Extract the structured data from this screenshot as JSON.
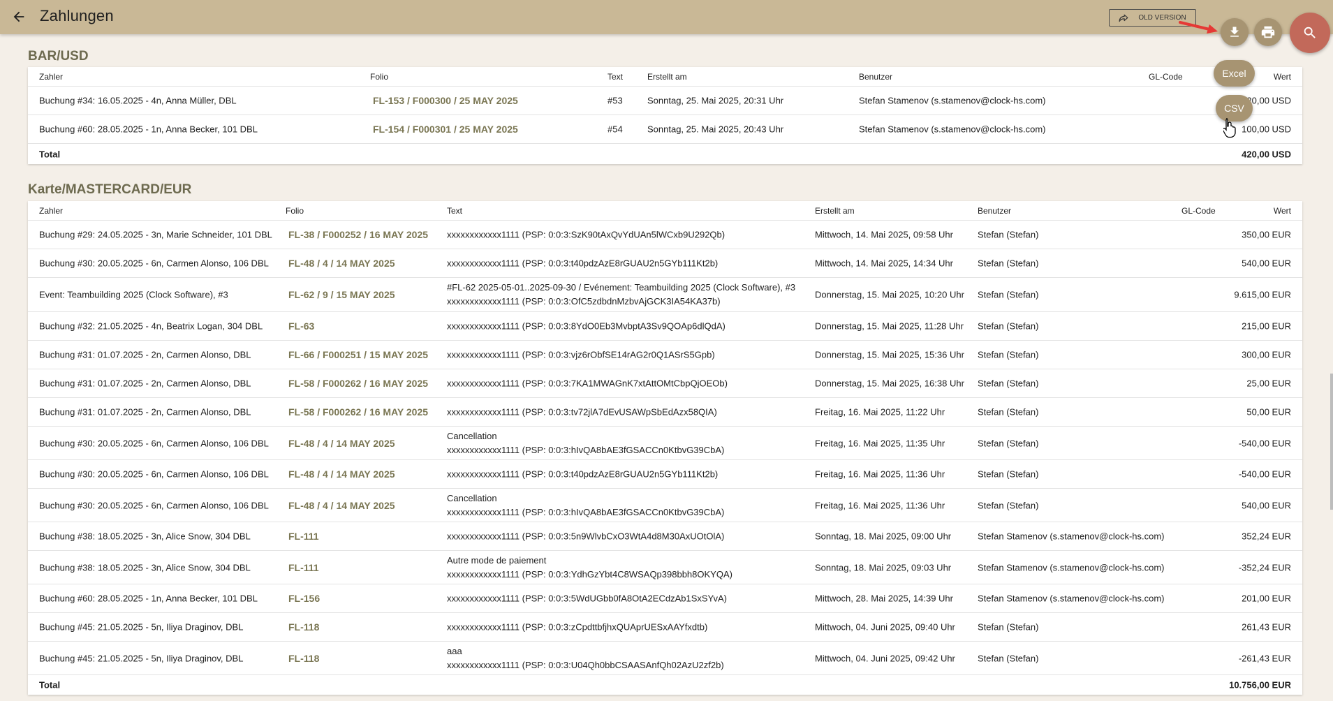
{
  "header": {
    "title": "Zahlungen",
    "old_version_label": "OLD VERSION"
  },
  "export": {
    "excel_label": "Excel",
    "csv_label": "CSV"
  },
  "icons": {
    "back": "arrow-left-icon",
    "old_version": "share-arrow-icon",
    "download": "download-icon",
    "print": "printer-icon",
    "search": "search-icon"
  },
  "colors": {
    "topbar": "#c9b896",
    "accent": "#a79472",
    "search_fab": "#c2695a",
    "folio_link": "#7a7653",
    "annotation_arrow": "#e53935"
  },
  "sections": [
    {
      "title": "BAR/USD",
      "columns": {
        "payer": "Zahler",
        "folio": "Folio",
        "text": "Text",
        "created": "Erstellt am",
        "user": "Benutzer",
        "gl": "GL-Code",
        "value": "Wert"
      },
      "rows": [
        {
          "payer": "Buchung #34: 16.05.2025 - 4n, Anna Müller, DBL",
          "folio": "FL-153 / F000300 / 25 MAY 2025",
          "text": "#53",
          "text2": "",
          "created": "Sonntag, 25. Mai 2025, 20:31 Uhr",
          "user": "Stefan Stamenov (s.stamenov@clock-hs.com)",
          "value": "320,00 USD"
        },
        {
          "payer": "Buchung #60: 28.05.2025 - 1n, Anna Becker, 101 DBL",
          "folio": "FL-154 / F000301 / 25 MAY 2025",
          "text": "#54",
          "text2": "",
          "created": "Sonntag, 25. Mai 2025, 20:43 Uhr",
          "user": "Stefan Stamenov (s.stamenov@clock-hs.com)",
          "value": "100,00 USD"
        }
      ],
      "total_label": "Total",
      "total_value": "420,00 USD"
    },
    {
      "title": "Karte/MASTERCARD/EUR",
      "columns": {
        "payer": "Zahler",
        "folio": "Folio",
        "text": "Text",
        "created": "Erstellt am",
        "user": "Benutzer",
        "gl": "GL-Code",
        "value": "Wert"
      },
      "rows": [
        {
          "payer": "Buchung #29: 24.05.2025 - 3n, Marie Schneider, 101 DBL",
          "folio": "FL-38 / F000252 / 16 MAY 2025",
          "text": "xxxxxxxxxxxx1111 (PSP: 0:0:3:SzK90tAxQvYdUAn5lWCxb9U292Qb)",
          "text2": "",
          "created": "Mittwoch, 14. Mai 2025, 09:58 Uhr",
          "user": "Stefan (Stefan)",
          "value": "350,00 EUR"
        },
        {
          "payer": "Buchung #30: 20.05.2025 - 6n, Carmen Alonso, 106 DBL",
          "folio": "FL-48 / 4 / 14 MAY 2025",
          "text": "xxxxxxxxxxxx1111 (PSP: 0:0:3:t40pdzAzE8rGUAU2n5GYb111Kt2b)",
          "text2": "",
          "created": "Mittwoch, 14. Mai 2025, 14:34 Uhr",
          "user": "Stefan (Stefan)",
          "value": "540,00 EUR"
        },
        {
          "payer": "Event: Teambuilding 2025 (Clock Software), #3",
          "folio": "FL-62 / 9 / 15 MAY 2025",
          "text": "#FL-62 2025-05-01..2025-09-30 / Evénement: Teambuilding 2025 (Clock Software), #3",
          "text2": "xxxxxxxxxxxx1111 (PSP: 0:0:3:OfC5zdbdnMzbvAjGCK3IA54KA37b)",
          "created": "Donnerstag, 15. Mai 2025, 10:20 Uhr",
          "user": "Stefan (Stefan)",
          "value": "9.615,00 EUR"
        },
        {
          "payer": "Buchung #32: 21.05.2025 - 4n, Beatrix Logan, 304 DBL",
          "folio": "FL-63",
          "text": "xxxxxxxxxxxx1111 (PSP: 0:0:3:8YdO0Eb3MvbptA3Sv9QOAp6dlQdA)",
          "text2": "",
          "created": "Donnerstag, 15. Mai 2025, 11:28 Uhr",
          "user": "Stefan (Stefan)",
          "value": "215,00 EUR"
        },
        {
          "payer": "Buchung #31: 01.07.2025 - 2n, Carmen Alonso, DBL",
          "folio": "FL-66 / F000251 / 15 MAY 2025",
          "text": "xxxxxxxxxxxx1111 (PSP: 0:0:3:vjz6rObfSE14rAG2r0Q1ASrS5Gpb)",
          "text2": "",
          "created": "Donnerstag, 15. Mai 2025, 15:36 Uhr",
          "user": "Stefan (Stefan)",
          "value": "300,00 EUR"
        },
        {
          "payer": "Buchung #31: 01.07.2025 - 2n, Carmen Alonso, DBL",
          "folio": "FL-58 / F000262 / 16 MAY 2025",
          "text": "xxxxxxxxxxxx1111 (PSP: 0:0:3:7KA1MWAGnK7xtAttOMtCbpQjOEOb)",
          "text2": "",
          "created": "Donnerstag, 15. Mai 2025, 16:38 Uhr",
          "user": "Stefan (Stefan)",
          "value": "25,00 EUR"
        },
        {
          "payer": "Buchung #31: 01.07.2025 - 2n, Carmen Alonso, DBL",
          "folio": "FL-58 / F000262 / 16 MAY 2025",
          "text": "xxxxxxxxxxxx1111 (PSP: 0:0:3:tv72jlA7dEvUSAWpSbEdAzx58QIA)",
          "text2": "",
          "created": "Freitag, 16. Mai 2025, 11:22 Uhr",
          "user": "Stefan (Stefan)",
          "value": "50,00 EUR"
        },
        {
          "payer": "Buchung #30: 20.05.2025 - 6n, Carmen Alonso, 106 DBL",
          "folio": "FL-48 / 4 / 14 MAY 2025",
          "text": "Cancellation",
          "text2": "xxxxxxxxxxxx1111 (PSP: 0:0:3:hIvQA8bAE3fGSACCn0KtbvG39CbA)",
          "created": "Freitag, 16. Mai 2025, 11:35 Uhr",
          "user": "Stefan (Stefan)",
          "value": "-540,00 EUR"
        },
        {
          "payer": "Buchung #30: 20.05.2025 - 6n, Carmen Alonso, 106 DBL",
          "folio": "FL-48 / 4 / 14 MAY 2025",
          "text": "xxxxxxxxxxxx1111 (PSP: 0:0:3:t40pdzAzE8rGUAU2n5GYb111Kt2b)",
          "text2": "",
          "created": "Freitag, 16. Mai 2025, 11:36 Uhr",
          "user": "Stefan (Stefan)",
          "value": "-540,00 EUR"
        },
        {
          "payer": "Buchung #30: 20.05.2025 - 6n, Carmen Alonso, 106 DBL",
          "folio": "FL-48 / 4 / 14 MAY 2025",
          "text": "Cancellation",
          "text2": "xxxxxxxxxxxx1111 (PSP: 0:0:3:hIvQA8bAE3fGSACCn0KtbvG39CbA)",
          "created": "Freitag, 16. Mai 2025, 11:36 Uhr",
          "user": "Stefan (Stefan)",
          "value": "540,00 EUR"
        },
        {
          "payer": "Buchung #38: 18.05.2025 - 3n, Alice Snow, 304 DBL",
          "folio": "FL-111",
          "text": "xxxxxxxxxxxx1111 (PSP: 0:0:3:5n9WlvbCxO3WtA4d8M30AxUOtOlA)",
          "text2": "",
          "created": "Sonntag, 18. Mai 2025, 09:00 Uhr",
          "user": "Stefan Stamenov (s.stamenov@clock-hs.com)",
          "value": "352,24 EUR"
        },
        {
          "payer": "Buchung #38: 18.05.2025 - 3n, Alice Snow, 304 DBL",
          "folio": "FL-111",
          "text": "Autre mode de paiement",
          "text2": "xxxxxxxxxxxx1111 (PSP: 0:0:3:YdhGzYbt4C8WSAQp398bbh8OKYQA)",
          "created": "Sonntag, 18. Mai 2025, 09:03 Uhr",
          "user": "Stefan Stamenov (s.stamenov@clock-hs.com)",
          "value": "-352,24 EUR"
        },
        {
          "payer": "Buchung #60: 28.05.2025 - 1n, Anna Becker, 101 DBL",
          "folio": "FL-156",
          "text": "xxxxxxxxxxxx1111 (PSP: 0:0:3:5WdUGbb0fA8OtA2ECdzAb1SxSYvA)",
          "text2": "",
          "created": "Mittwoch, 28. Mai 2025, 14:39 Uhr",
          "user": "Stefan Stamenov (s.stamenov@clock-hs.com)",
          "value": "201,00 EUR"
        },
        {
          "payer": "Buchung #45: 21.05.2025 - 5n, Iliya Draginov, DBL",
          "folio": "FL-118",
          "text": "xxxxxxxxxxxx1111 (PSP: 0:0:3:zCpdttbfjhxQUAprUESxAAYfxdtb)",
          "text2": "",
          "created": "Mittwoch, 04. Juni 2025, 09:40 Uhr",
          "user": "Stefan (Stefan)",
          "value": "261,43 EUR"
        },
        {
          "payer": "Buchung #45: 21.05.2025 - 5n, Iliya Draginov, DBL",
          "folio": "FL-118",
          "text": "aaa",
          "text2": "xxxxxxxxxxxx1111 (PSP: 0:0:3:U04Qh0bbCSAASAnfQh02AzU2zf2b)",
          "created": "Mittwoch, 04. Juni 2025, 09:42 Uhr",
          "user": "Stefan (Stefan)",
          "value": "-261,43 EUR"
        }
      ],
      "total_label": "Total",
      "total_value": "10.756,00 EUR"
    }
  ]
}
